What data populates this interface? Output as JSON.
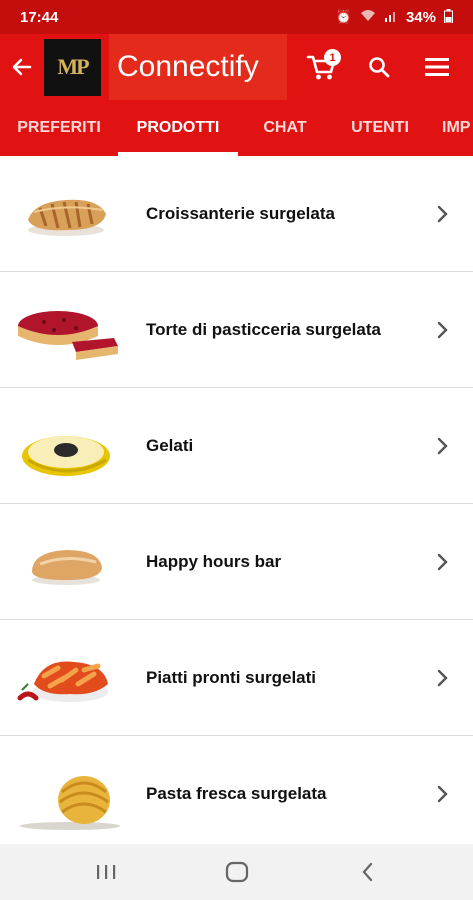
{
  "status": {
    "time": "17:44",
    "battery": "34%"
  },
  "appbar": {
    "logo_text": "MP",
    "title": "Connectify",
    "cart_count": "1"
  },
  "tabs": [
    {
      "label": "PREFERITI",
      "active": false
    },
    {
      "label": "PRODOTTI",
      "active": true
    },
    {
      "label": "CHAT",
      "active": false
    },
    {
      "label": "UTENTI",
      "active": false
    },
    {
      "label": "IMP",
      "active": false
    }
  ],
  "categories": [
    {
      "label": "Croissanterie surgelata",
      "icon": "croissant-image"
    },
    {
      "label": "Torte di pasticceria surgelata",
      "icon": "cake-image"
    },
    {
      "label": "Gelati",
      "icon": "gelato-image"
    },
    {
      "label": "Happy hours bar",
      "icon": "bread-image"
    },
    {
      "label": "Piatti pronti surgelati",
      "icon": "pasta-dish-image"
    },
    {
      "label": "Pasta fresca surgelata",
      "icon": "tagliatelle-image"
    }
  ],
  "colors": {
    "primary": "#e11212",
    "statusbar": "#c40d0d",
    "navbar": "#f2f2f2"
  }
}
